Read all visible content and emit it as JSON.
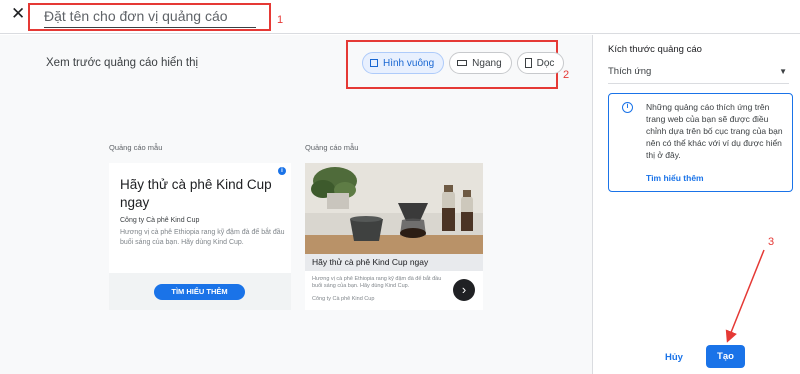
{
  "header": {
    "close_icon": "close-icon",
    "ad_unit_name_placeholder": "Đặt tên cho đơn vị quảng cáo"
  },
  "annotations": {
    "label_1": "1",
    "label_2": "2",
    "label_3": "3",
    "color": "#e53935"
  },
  "main": {
    "preview_label": "Xem trước quảng cáo hiển thị",
    "shape_chips": [
      {
        "label": "Hình vuông",
        "icon": "square-icon",
        "selected": true
      },
      {
        "label": "Ngang",
        "icon": "landscape-icon",
        "selected": false
      },
      {
        "label": "Dọc",
        "icon": "portrait-icon",
        "selected": false
      }
    ],
    "samples": [
      {
        "label": "Quảng cáo mẫu",
        "title": "Hãy thử cà phê Kind Cup ngay",
        "company": "Công ty Cà phê Kind Cup",
        "description": "Hương vị cà phê Ethiopia rang kỹ đậm đà để bắt đầu buổi sáng của bạn. Hãy dùng Kind Cup.",
        "cta": "TÌM HIỂU THÊM"
      },
      {
        "label": "Quảng cáo mẫu",
        "title": "Hãy thử cà phê Kind Cup ngay",
        "description": "Hương vị cà phê Ethiopia rang kỹ đậm đà để bắt đầu buổi sáng của bạn. Hãy dùng Kind Cup.",
        "company": "Công ty Cà phê Kind Cup",
        "arrow_icon": "chevron-right-icon"
      }
    ]
  },
  "panel": {
    "title": "Kích thước quảng cáo",
    "size_value": "Thích ứng",
    "info_text": "Những quảng cáo thích ứng trên trang web của bạn sẽ được điều chỉnh dựa trên bố cục trang của bạn nên có thể khác với ví dụ được hiển thị ở đây.",
    "info_link": "Tìm hiểu thêm",
    "cancel_label": "Hủy",
    "create_label": "Tạo"
  },
  "colors": {
    "accent": "#1a73e8",
    "chip_selected_bg": "#e8f0fe"
  }
}
